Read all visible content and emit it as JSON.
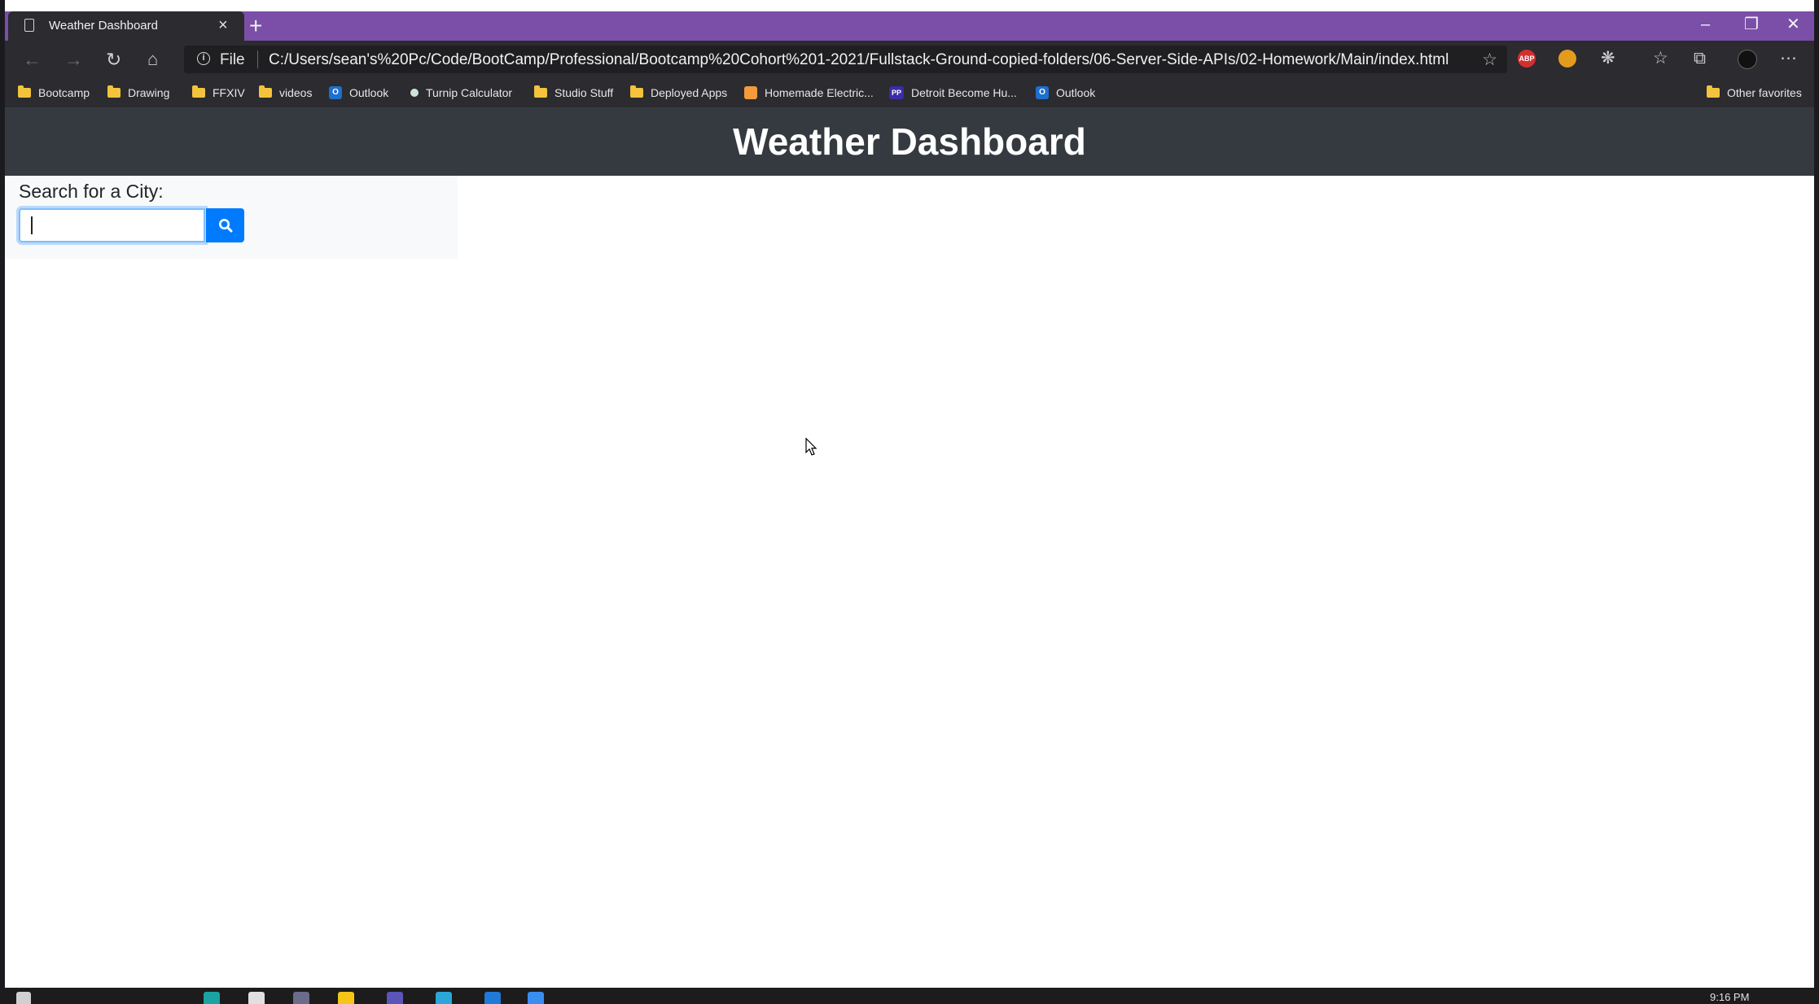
{
  "browser": {
    "tab": {
      "title": "Weather Dashboard",
      "close": "×"
    },
    "new_tab": "+",
    "window_controls": {
      "minimize": "–",
      "restore": "❐",
      "close": "✕"
    },
    "address": {
      "scheme": "File",
      "url": "C:/Users/sean's%20Pc/Code/BootCamp/Professional/Bootcamp%20Cohort%201-2021/Fullstack-Ground-copied-folders/06-Server-Side-APIs/02-Homework/Main/index.html"
    },
    "extensions": {
      "adblock": "ABP"
    },
    "bookmarks": [
      {
        "label": "Bootcamp",
        "icon": "folder-icon"
      },
      {
        "label": "Drawing",
        "icon": "folder-icon"
      },
      {
        "label": "FFXIV",
        "icon": "folder-icon"
      },
      {
        "label": "videos",
        "icon": "folder-icon"
      },
      {
        "label": "Outlook",
        "icon": "outlook-icon"
      },
      {
        "label": "Turnip Calculator",
        "icon": "dot-icon"
      },
      {
        "label": "Studio Stuff",
        "icon": "folder-icon"
      },
      {
        "label": "Deployed Apps",
        "icon": "folder-icon"
      },
      {
        "label": "Homemade Electric...",
        "icon": "site-icon"
      },
      {
        "label": "Detroit Become Hu...",
        "icon": "pp-icon"
      },
      {
        "label": "Outlook",
        "icon": "outlook-icon"
      }
    ],
    "other_favorites": "Other favorites"
  },
  "page": {
    "title": "Weather Dashboard",
    "search_label": "Search for a City:",
    "search_input_value": "",
    "search_button_icon": "search-icon"
  },
  "taskbar": {
    "clock": "9:16 PM"
  },
  "colors": {
    "tab_strip": "#7b4fa8",
    "header_bg": "#343a40",
    "search_button": "#007bff",
    "search_panel_bg": "#f8f9fa"
  }
}
